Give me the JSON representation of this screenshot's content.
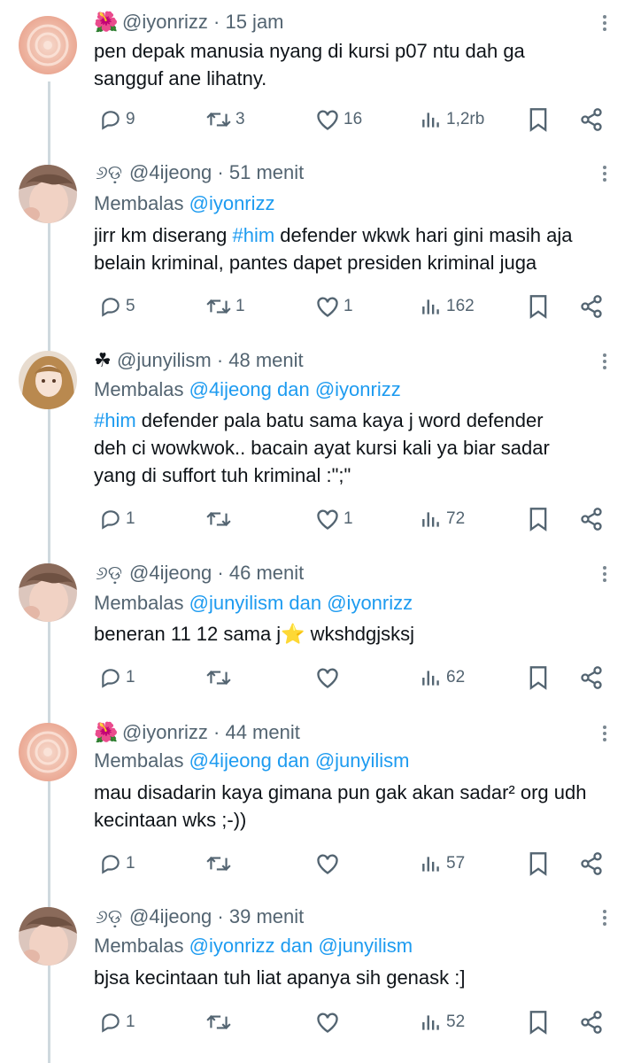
{
  "tweets": [
    {
      "emoji": "🌺",
      "handle": "@iyonrizz",
      "time": "· 15 jam",
      "reply_prefix": "",
      "reply_names": "",
      "body_hashtag": "",
      "body": "pen depak manusia nyang di kursi p07 ntu dah ga\nsangguf ane lihatny.",
      "replies": "9",
      "reposts": "3",
      "likes": "16",
      "views": "1,2rb"
    },
    {
      "emoji": "୬ଡ଼",
      "handle": "@4ijeong",
      "time": "· 51 menit",
      "reply_prefix": "Membalas",
      "reply_names": "@iyonrizz",
      "body_hashtag": "",
      "body_pre": "jirr km diserang ",
      "body_tag": "#him",
      "body_post": " defender wkwk hari gini masih aja\nbelain kriminal, pantes dapet presiden kriminal juga",
      "replies": "5",
      "reposts": "1",
      "likes": "1",
      "views": "162"
    },
    {
      "emoji": "☘",
      "handle": "@junyilism",
      "time": "· 48 menit",
      "reply_prefix": "Membalas",
      "reply_names": "@4ijeong dan @iyonrizz",
      "body_tag": "#him",
      "body_post": " defender pala batu sama kaya j word defender\ndeh ci wowkwok.. bacain ayat kursi kali ya biar sadar\nyang di suffort tuh kriminal :\";\"",
      "replies": "1",
      "reposts": "",
      "likes": "1",
      "views": "72"
    },
    {
      "emoji": "୬ଡ଼",
      "handle": "@4ijeong",
      "time": "· 46 menit",
      "reply_prefix": "Membalas",
      "reply_names": "@junyilism dan @iyonrizz",
      "body": "beneran 11 12 sama j⭐ wkshdgjsksj",
      "replies": "1",
      "reposts": "",
      "likes": "",
      "views": "62"
    },
    {
      "emoji": "🌺",
      "handle": "@iyonrizz",
      "time": "· 44 menit",
      "reply_prefix": "Membalas",
      "reply_names": "@4ijeong dan @junyilism",
      "body": "mau disadarin kaya gimana pun gak akan sadar² org udh\nkecintaan wks ;-))",
      "replies": "1",
      "reposts": "",
      "likes": "",
      "views": "57"
    },
    {
      "emoji": "୬ଡ଼",
      "handle": "@4ijeong",
      "time": "· 39 menit",
      "reply_prefix": "Membalas",
      "reply_names": "@iyonrizz dan @junyilism",
      "body": "bjsa kecintaan tuh liat apanya sih genask :]",
      "replies": "1",
      "reposts": "",
      "likes": "",
      "views": "52"
    }
  ],
  "icons": {
    "reply": "reply-icon",
    "repost": "repost-icon",
    "like": "heart-icon",
    "views": "views-icon",
    "bookmark": "bookmark-icon",
    "share": "share-icon"
  },
  "colors": {
    "link": "#1d9bf0",
    "muted": "#536471",
    "text": "#0f1419",
    "thread_line": "#cfd9de"
  }
}
